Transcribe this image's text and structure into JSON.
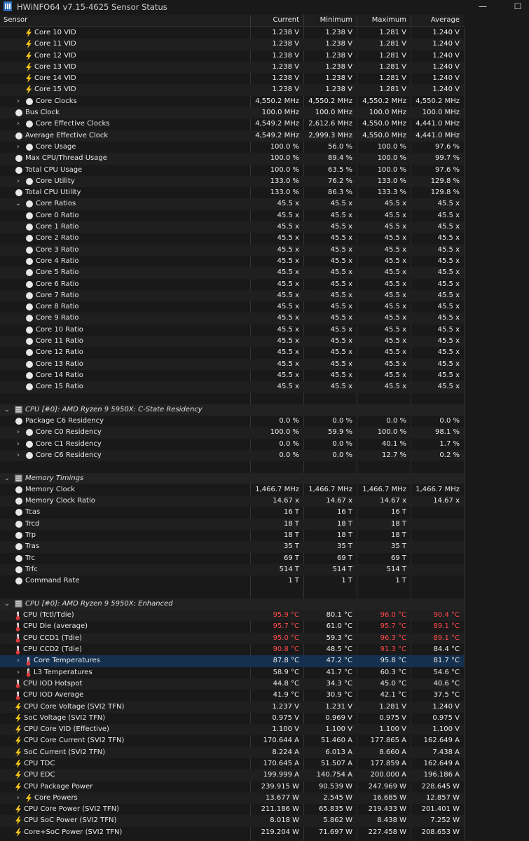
{
  "window": {
    "title": "HWiNFO64 v7.15-4625 Sensor Status",
    "minimize": "—",
    "maximize": "☐"
  },
  "columns": [
    "Sensor",
    "Current",
    "Minimum",
    "Maximum",
    "Average"
  ],
  "rows": [
    {
      "label": "Core 10 VID",
      "icon": "bolt",
      "indent": 2,
      "values": [
        "1.238 V",
        "1.238 V",
        "1.281 V",
        "1.240 V"
      ]
    },
    {
      "label": "Core 11 VID",
      "icon": "bolt",
      "indent": 2,
      "values": [
        "1.238 V",
        "1.238 V",
        "1.281 V",
        "1.240 V"
      ]
    },
    {
      "label": "Core 12 VID",
      "icon": "bolt",
      "indent": 2,
      "values": [
        "1.238 V",
        "1.238 V",
        "1.281 V",
        "1.240 V"
      ]
    },
    {
      "label": "Core 13 VID",
      "icon": "bolt",
      "indent": 2,
      "values": [
        "1.238 V",
        "1.238 V",
        "1.281 V",
        "1.240 V"
      ]
    },
    {
      "label": "Core 14 VID",
      "icon": "bolt",
      "indent": 2,
      "values": [
        "1.238 V",
        "1.238 V",
        "1.281 V",
        "1.240 V"
      ]
    },
    {
      "label": "Core 15 VID",
      "icon": "bolt",
      "indent": 2,
      "values": [
        "1.238 V",
        "1.238 V",
        "1.281 V",
        "1.240 V"
      ]
    },
    {
      "label": "Core Clocks",
      "icon": "circle",
      "indent": 1,
      "expander": "collapsed",
      "values": [
        "4,550.2 MHz",
        "4,550.2 MHz",
        "4,550.2 MHz",
        "4,550.2 MHz"
      ]
    },
    {
      "label": "Bus Clock",
      "icon": "circle",
      "indent": 0,
      "values": [
        "100.0 MHz",
        "100.0 MHz",
        "100.0 MHz",
        "100.0 MHz"
      ]
    },
    {
      "label": "Core Effective Clocks",
      "icon": "circle",
      "indent": 1,
      "expander": "collapsed",
      "values": [
        "4,549.2 MHz",
        "2,612.6 MHz",
        "4,550.0 MHz",
        "4,441.0 MHz"
      ]
    },
    {
      "label": "Average Effective Clock",
      "icon": "circle",
      "indent": 0,
      "values": [
        "4,549.2 MHz",
        "2,999.3 MHz",
        "4,550.0 MHz",
        "4,441.0 MHz"
      ]
    },
    {
      "label": "Core Usage",
      "icon": "circle",
      "indent": 1,
      "expander": "collapsed",
      "values": [
        "100.0 %",
        "56.0 %",
        "100.0 %",
        "97.6 %"
      ]
    },
    {
      "label": "Max CPU/Thread Usage",
      "icon": "circle",
      "indent": 0,
      "values": [
        "100.0 %",
        "89.4 %",
        "100.0 %",
        "99.7 %"
      ]
    },
    {
      "label": "Total CPU Usage",
      "icon": "circle",
      "indent": 0,
      "values": [
        "100.0 %",
        "63.5 %",
        "100.0 %",
        "97.6 %"
      ]
    },
    {
      "label": "Core Utility",
      "icon": "circle",
      "indent": 1,
      "expander": "collapsed",
      "values": [
        "133.0 %",
        "76.2 %",
        "133.0 %",
        "129.8 %"
      ]
    },
    {
      "label": "Total CPU Utility",
      "icon": "circle",
      "indent": 0,
      "values": [
        "133.0 %",
        "86.3 %",
        "133.3 %",
        "129.8 %"
      ]
    },
    {
      "label": "Core Ratios",
      "icon": "circle",
      "indent": 1,
      "expander": "expanded",
      "values": [
        "45.5 x",
        "45.5 x",
        "45.5 x",
        "45.5 x"
      ]
    },
    {
      "label": "Core 0 Ratio",
      "icon": "circle",
      "indent": 2,
      "values": [
        "45.5 x",
        "45.5 x",
        "45.5 x",
        "45.5 x"
      ]
    },
    {
      "label": "Core 1 Ratio",
      "icon": "circle",
      "indent": 2,
      "values": [
        "45.5 x",
        "45.5 x",
        "45.5 x",
        "45.5 x"
      ]
    },
    {
      "label": "Core 2 Ratio",
      "icon": "circle",
      "indent": 2,
      "values": [
        "45.5 x",
        "45.5 x",
        "45.5 x",
        "45.5 x"
      ]
    },
    {
      "label": "Core 3 Ratio",
      "icon": "circle",
      "indent": 2,
      "values": [
        "45.5 x",
        "45.5 x",
        "45.5 x",
        "45.5 x"
      ]
    },
    {
      "label": "Core 4 Ratio",
      "icon": "circle",
      "indent": 2,
      "values": [
        "45.5 x",
        "45.5 x",
        "45.5 x",
        "45.5 x"
      ]
    },
    {
      "label": "Core 5 Ratio",
      "icon": "circle",
      "indent": 2,
      "values": [
        "45.5 x",
        "45.5 x",
        "45.5 x",
        "45.5 x"
      ]
    },
    {
      "label": "Core 6 Ratio",
      "icon": "circle",
      "indent": 2,
      "values": [
        "45.5 x",
        "45.5 x",
        "45.5 x",
        "45.5 x"
      ]
    },
    {
      "label": "Core 7 Ratio",
      "icon": "circle",
      "indent": 2,
      "values": [
        "45.5 x",
        "45.5 x",
        "45.5 x",
        "45.5 x"
      ]
    },
    {
      "label": "Core 8 Ratio",
      "icon": "circle",
      "indent": 2,
      "values": [
        "45.5 x",
        "45.5 x",
        "45.5 x",
        "45.5 x"
      ]
    },
    {
      "label": "Core 9 Ratio",
      "icon": "circle",
      "indent": 2,
      "values": [
        "45.5 x",
        "45.5 x",
        "45.5 x",
        "45.5 x"
      ]
    },
    {
      "label": "Core 10 Ratio",
      "icon": "circle",
      "indent": 2,
      "values": [
        "45.5 x",
        "45.5 x",
        "45.5 x",
        "45.5 x"
      ]
    },
    {
      "label": "Core 11 Ratio",
      "icon": "circle",
      "indent": 2,
      "values": [
        "45.5 x",
        "45.5 x",
        "45.5 x",
        "45.5 x"
      ]
    },
    {
      "label": "Core 12 Ratio",
      "icon": "circle",
      "indent": 2,
      "values": [
        "45.5 x",
        "45.5 x",
        "45.5 x",
        "45.5 x"
      ]
    },
    {
      "label": "Core 13 Ratio",
      "icon": "circle",
      "indent": 2,
      "values": [
        "45.5 x",
        "45.5 x",
        "45.5 x",
        "45.5 x"
      ]
    },
    {
      "label": "Core 14 Ratio",
      "icon": "circle",
      "indent": 2,
      "values": [
        "45.5 x",
        "45.5 x",
        "45.5 x",
        "45.5 x"
      ]
    },
    {
      "label": "Core 15 Ratio",
      "icon": "circle",
      "indent": 2,
      "values": [
        "45.5 x",
        "45.5 x",
        "45.5 x",
        "45.5 x"
      ]
    },
    {
      "blank": true
    },
    {
      "label": "CPU [#0]: AMD Ryzen 9 5950X: C-State Residency",
      "icon": "chip",
      "group": true,
      "expander": "expanded",
      "values": [
        "",
        "",
        "",
        ""
      ]
    },
    {
      "label": "Package C6 Residency",
      "icon": "circle",
      "indent": 0,
      "values": [
        "0.0 %",
        "0.0 %",
        "0.0 %",
        "0.0 %"
      ]
    },
    {
      "label": "Core C0 Residency",
      "icon": "circle",
      "indent": 1,
      "expander": "collapsed",
      "values": [
        "100.0 %",
        "59.9 %",
        "100.0 %",
        "98.1 %"
      ]
    },
    {
      "label": "Core C1 Residency",
      "icon": "circle",
      "indent": 1,
      "expander": "collapsed",
      "values": [
        "0.0 %",
        "0.0 %",
        "40.1 %",
        "1.7 %"
      ]
    },
    {
      "label": "Core C6 Residency",
      "icon": "circle",
      "indent": 1,
      "expander": "collapsed",
      "values": [
        "0.0 %",
        "0.0 %",
        "12.7 %",
        "0.2 %"
      ]
    },
    {
      "blank": true
    },
    {
      "label": "Memory Timings",
      "icon": "chip",
      "group": true,
      "expander": "expanded",
      "values": [
        "",
        "",
        "",
        ""
      ]
    },
    {
      "label": "Memory Clock",
      "icon": "circle",
      "indent": 0,
      "values": [
        "1,466.7 MHz",
        "1,466.7 MHz",
        "1,466.7 MHz",
        "1,466.7 MHz"
      ]
    },
    {
      "label": "Memory Clock Ratio",
      "icon": "circle",
      "indent": 0,
      "values": [
        "14.67 x",
        "14.67 x",
        "14.67 x",
        "14.67 x"
      ]
    },
    {
      "label": "Tcas",
      "icon": "circle",
      "indent": 0,
      "values": [
        "16 T",
        "16 T",
        "16 T",
        ""
      ]
    },
    {
      "label": "Trcd",
      "icon": "circle",
      "indent": 0,
      "values": [
        "18 T",
        "18 T",
        "18 T",
        ""
      ]
    },
    {
      "label": "Trp",
      "icon": "circle",
      "indent": 0,
      "values": [
        "18 T",
        "18 T",
        "18 T",
        ""
      ]
    },
    {
      "label": "Tras",
      "icon": "circle",
      "indent": 0,
      "values": [
        "35 T",
        "35 T",
        "35 T",
        ""
      ]
    },
    {
      "label": "Trc",
      "icon": "circle",
      "indent": 0,
      "values": [
        "69 T",
        "69 T",
        "69 T",
        ""
      ]
    },
    {
      "label": "Trfc",
      "icon": "circle",
      "indent": 0,
      "values": [
        "514 T",
        "514 T",
        "514 T",
        ""
      ]
    },
    {
      "label": "Command Rate",
      "icon": "circle",
      "indent": 0,
      "values": [
        "1 T",
        "1 T",
        "1 T",
        ""
      ]
    },
    {
      "blank": true
    },
    {
      "label": "CPU [#0]: AMD Ryzen 9 5950X: Enhanced",
      "icon": "chip",
      "group": true,
      "expander": "expanded",
      "values": [
        "",
        "",
        "",
        ""
      ]
    },
    {
      "label": "CPU (Tctl/Tdie)",
      "icon": "therm",
      "indent": 0,
      "values": [
        "95.9 °C",
        "80.1 °C",
        "96.0 °C",
        "90.4 °C"
      ],
      "hot": [
        true,
        false,
        true,
        true
      ]
    },
    {
      "label": "CPU Die (average)",
      "icon": "therm",
      "indent": 0,
      "values": [
        "95.7 °C",
        "61.0 °C",
        "95.7 °C",
        "89.1 °C"
      ],
      "hot": [
        true,
        false,
        true,
        true
      ]
    },
    {
      "label": "CPU CCD1 (Tdie)",
      "icon": "therm",
      "indent": 0,
      "values": [
        "95.0 °C",
        "59.3 °C",
        "96.3 °C",
        "89.1 °C"
      ],
      "hot": [
        true,
        false,
        true,
        true
      ]
    },
    {
      "label": "CPU CCD2 (Tdie)",
      "icon": "therm",
      "indent": 0,
      "values": [
        "90.8 °C",
        "48.5 °C",
        "91.3 °C",
        "84.4 °C"
      ],
      "hot": [
        true,
        false,
        true,
        false
      ]
    },
    {
      "label": "Core Temperatures",
      "icon": "therm",
      "indent": 1,
      "expander": "collapsed",
      "selected": true,
      "values": [
        "87.8 °C",
        "47.2 °C",
        "95.8 °C",
        "81.7 °C"
      ]
    },
    {
      "label": "L3 Temperatures",
      "icon": "therm",
      "indent": 1,
      "expander": "collapsed",
      "values": [
        "58.9 °C",
        "41.7 °C",
        "60.3 °C",
        "54.6 °C"
      ]
    },
    {
      "label": "CPU IOD Hotspot",
      "icon": "therm",
      "indent": 0,
      "values": [
        "44.8 °C",
        "34.3 °C",
        "45.0 °C",
        "40.6 °C"
      ]
    },
    {
      "label": "CPU IOD Average",
      "icon": "therm",
      "indent": 0,
      "values": [
        "41.9 °C",
        "30.9 °C",
        "42.1 °C",
        "37.5 °C"
      ]
    },
    {
      "label": "CPU Core Voltage (SVI2 TFN)",
      "icon": "bolt",
      "indent": 0,
      "values": [
        "1.237 V",
        "1.231 V",
        "1.281 V",
        "1.240 V"
      ]
    },
    {
      "label": "SoC Voltage (SVI2 TFN)",
      "icon": "bolt",
      "indent": 0,
      "values": [
        "0.975 V",
        "0.969 V",
        "0.975 V",
        "0.975 V"
      ]
    },
    {
      "label": "CPU Core VID (Effective)",
      "icon": "bolt",
      "indent": 0,
      "values": [
        "1.100 V",
        "1.100 V",
        "1.100 V",
        "1.100 V"
      ]
    },
    {
      "label": "CPU Core Current (SVI2 TFN)",
      "icon": "bolt",
      "indent": 0,
      "values": [
        "170.644 A",
        "51.460 A",
        "177.865 A",
        "162.649 A"
      ]
    },
    {
      "label": "SoC Current (SVI2 TFN)",
      "icon": "bolt",
      "indent": 0,
      "values": [
        "8.224 A",
        "6.013 A",
        "8.660 A",
        "7.438 A"
      ]
    },
    {
      "label": "CPU TDC",
      "icon": "bolt",
      "indent": 0,
      "values": [
        "170.645 A",
        "51.507 A",
        "177.859 A",
        "162.649 A"
      ]
    },
    {
      "label": "CPU EDC",
      "icon": "bolt",
      "indent": 0,
      "values": [
        "199.999 A",
        "140.754 A",
        "200.000 A",
        "196.186 A"
      ]
    },
    {
      "label": "CPU Package Power",
      "icon": "bolt",
      "indent": 0,
      "values": [
        "239.915 W",
        "90.539 W",
        "247.969 W",
        "228.645 W"
      ]
    },
    {
      "label": "Core Powers",
      "icon": "bolt",
      "indent": 1,
      "expander": "collapsed",
      "values": [
        "13.677 W",
        "2.545 W",
        "16.685 W",
        "12.857 W"
      ]
    },
    {
      "label": "CPU Core Power (SVI2 TFN)",
      "icon": "bolt",
      "indent": 0,
      "values": [
        "211.186 W",
        "65.835 W",
        "219.433 W",
        "201.401 W"
      ]
    },
    {
      "label": "CPU SoC Power (SVI2 TFN)",
      "icon": "bolt",
      "indent": 0,
      "values": [
        "8.018 W",
        "5.862 W",
        "8.438 W",
        "7.252 W"
      ]
    },
    {
      "label": "Core+SoC Power (SVI2 TFN)",
      "icon": "bolt",
      "indent": 0,
      "values": [
        "219.204 W",
        "71.697 W",
        "227.458 W",
        "208.653 W"
      ]
    }
  ]
}
